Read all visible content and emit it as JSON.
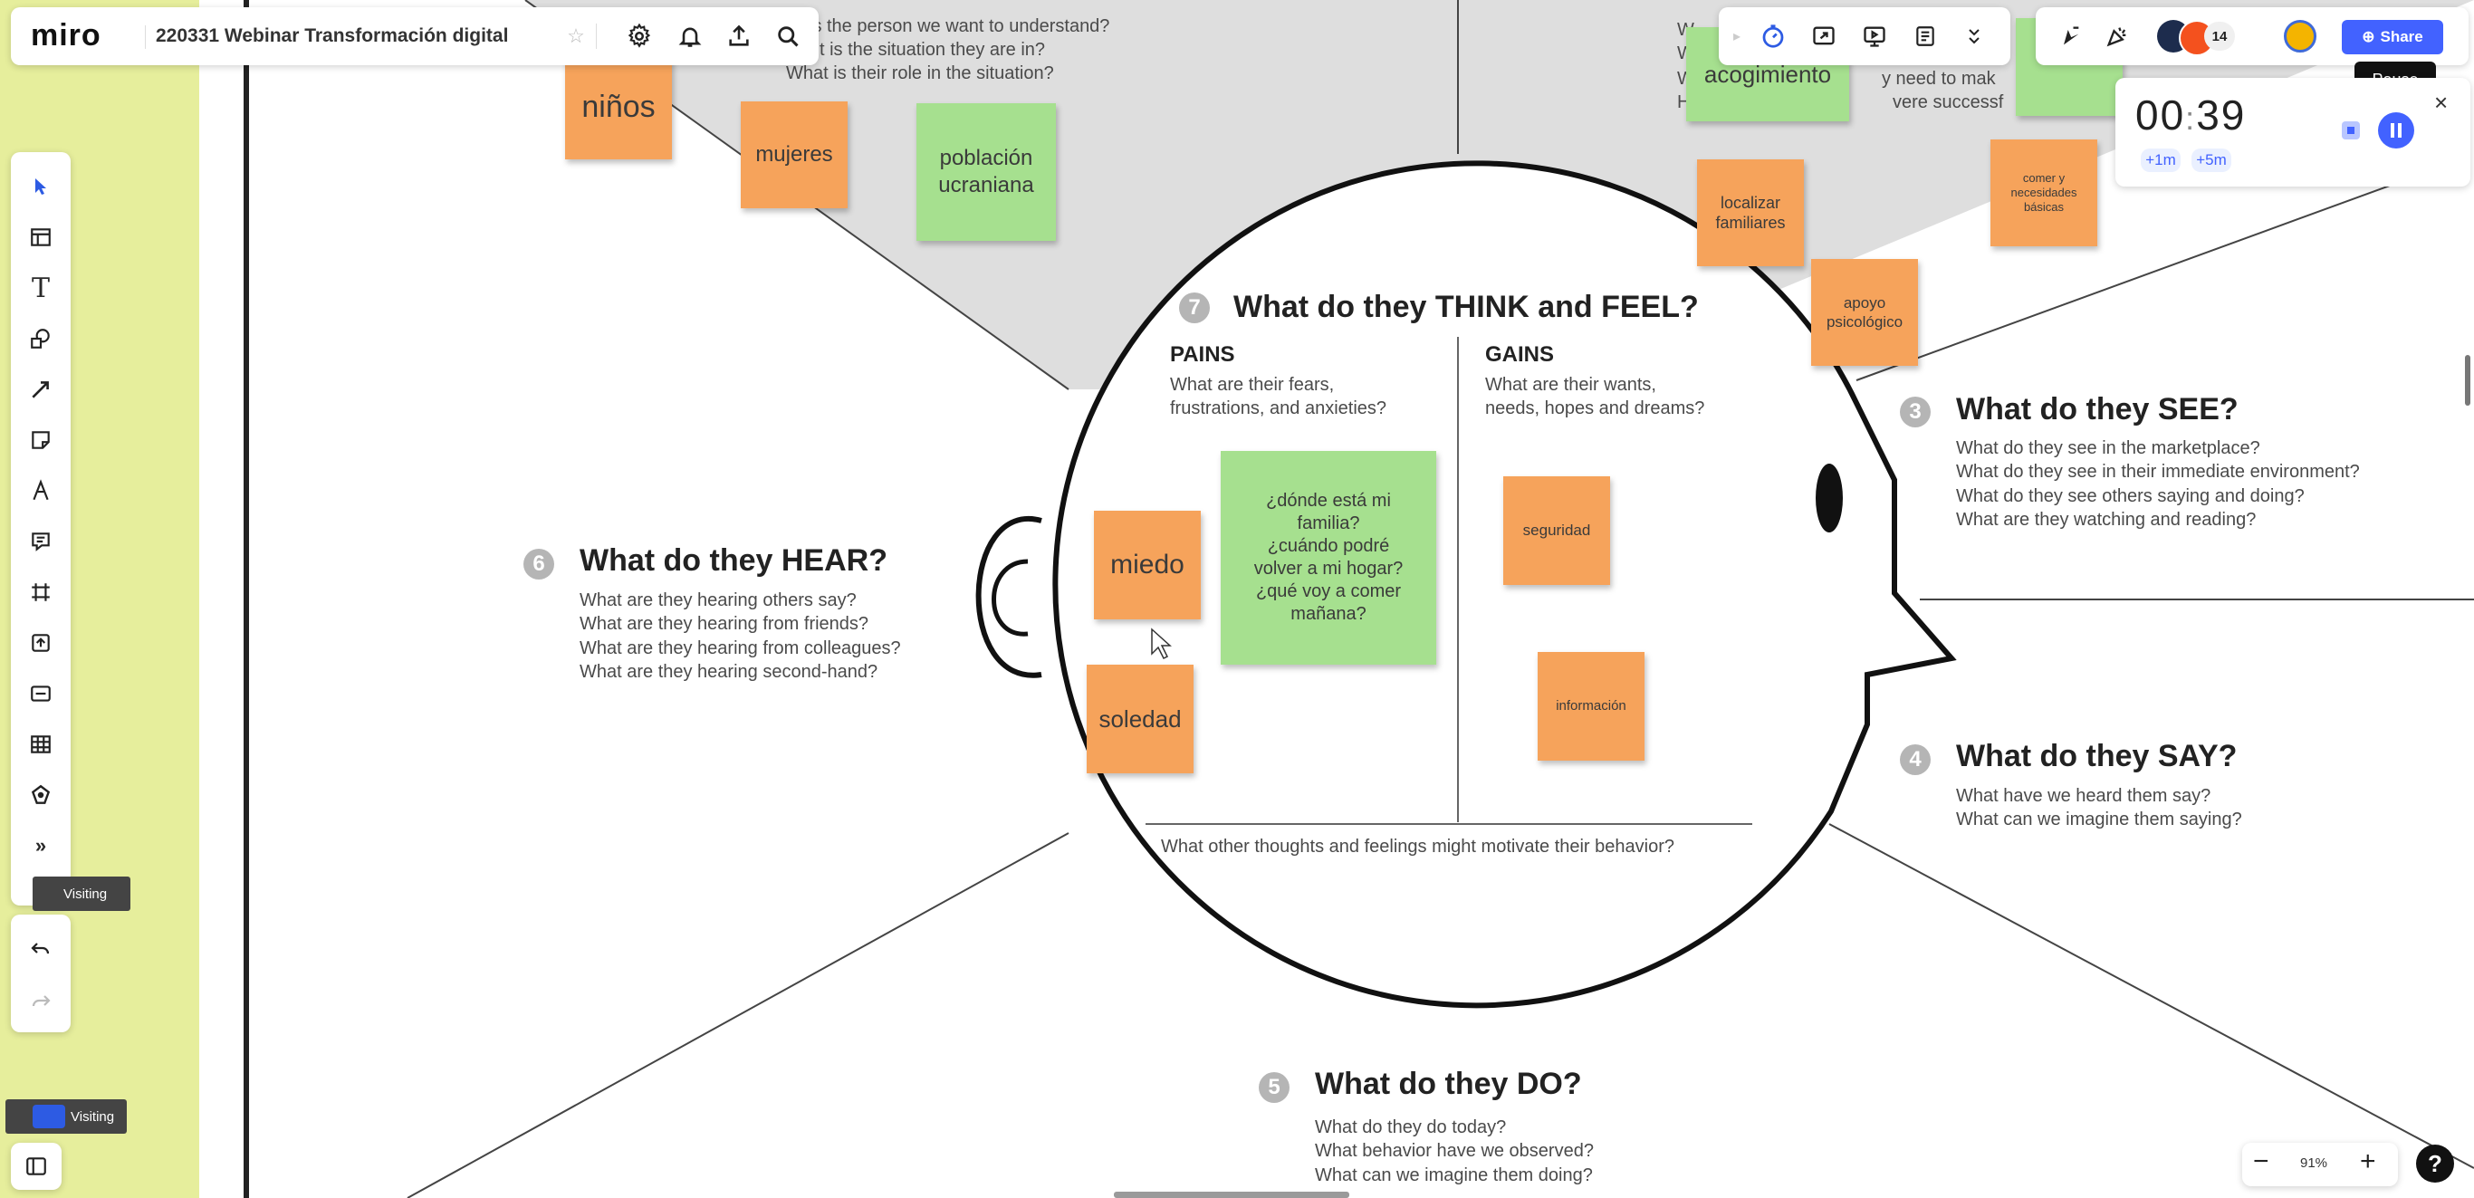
{
  "app": {
    "logo": "miro",
    "board_title": "220331 Webinar Transformación digital"
  },
  "toolbar_left": {
    "tools": [
      "select-icon",
      "frame-icon",
      "text-icon",
      "shapes-icon",
      "line-icon",
      "sticky-note-icon",
      "pen-icon",
      "comment-icon",
      "frame-tool-icon",
      "upload-icon",
      "card-icon",
      "table-icon",
      "template-icon",
      "more-icon"
    ],
    "visiting_label_1": "Visiting",
    "visiting_label_2": "Visiting"
  },
  "toolbar_right": {
    "collaborator_count": "14",
    "share_label": "Share"
  },
  "timer": {
    "tooltip": "Pause",
    "minutes": "00",
    "seconds": "39",
    "add_1m": "+1m",
    "add_5m": "+5m"
  },
  "zoom": {
    "minus": "−",
    "level": "91%",
    "plus": "+",
    "help": "?"
  },
  "board": {
    "top_left_questions": [
      "is the person we want to understand?",
      "t is the situation they are in?",
      "What is their role in the situation?"
    ],
    "top_right_fragments": {
      "left_letters": [
        "W",
        "W",
        "W",
        "Ho"
      ],
      "line1": "y need to mak",
      "line2": "vere successf"
    },
    "think_feel": {
      "number": "7",
      "title": "What do they THINK and FEEL?",
      "pains_title": "PAINS",
      "pains_text": "What are their fears,\nfrustrations, and anxieties?",
      "gains_title": "GAINS",
      "gains_text": "What are their wants,\nneeds, hopes and dreams?",
      "bottom_text": "What other thoughts and feelings might motivate their behavior?"
    },
    "see": {
      "number": "3",
      "title": "What do they SEE?",
      "text": "What do they see in the marketplace?\nWhat do they see in their immediate environment?\nWhat do they see others saying and doing?\nWhat are they watching and reading?"
    },
    "hear": {
      "number": "6",
      "title": "What do they HEAR?",
      "text": "What are they hearing others say?\nWhat are they hearing from friends?\nWhat are they hearing from colleagues?\nWhat are they hearing second-hand?"
    },
    "say": {
      "number": "4",
      "title": "What do they SAY?",
      "text": "What have we heard them say?\nWhat can we imagine them saying?"
    },
    "do": {
      "number": "5",
      "title": "What do they DO?",
      "text": "What do they do today?\nWhat behavior have we observed?\nWhat can we imagine them doing?"
    }
  },
  "stickies": {
    "ninos": "niños",
    "mujeres": "mujeres",
    "poblacion": "población\nucraniana",
    "acogimiento": "acogimiento",
    "localizar": "localizar\nfamiliares",
    "apoyo": "apoyo\npsicológico",
    "comer": "comer y\nnecesidades\nbásicas",
    "miedo": "miedo",
    "soledad": "soledad",
    "donde": "¿dónde está mi\nfamilia?\n¿cuándo podré\nvolver a mi hogar?\n¿qué voy a comer\nmañana?",
    "seguridad": "seguridad",
    "informacion": "información"
  }
}
